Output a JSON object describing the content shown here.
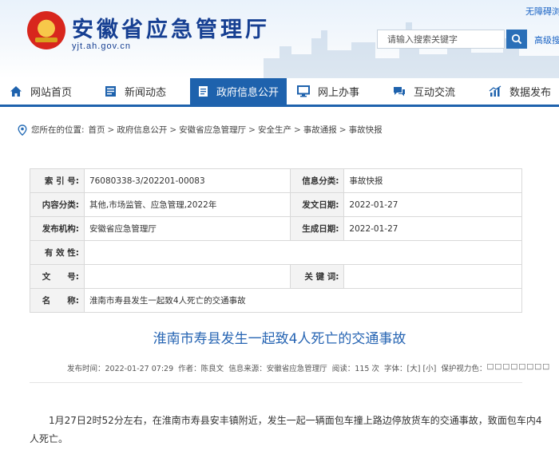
{
  "header": {
    "site_title": "安徽省应急管理厅",
    "site_domain": "yjt.ah.gov.cn",
    "a11y_link": "无障碍浏",
    "search_placeholder": "请输入搜索关键字",
    "advanced_search": "高级搜"
  },
  "nav": {
    "items": [
      {
        "label": "网站首页",
        "icon": "home-icon"
      },
      {
        "label": "新闻动态",
        "icon": "news-icon"
      },
      {
        "label": "政府信息公开",
        "icon": "document-icon",
        "active": true
      },
      {
        "label": "网上办事",
        "icon": "monitor-icon"
      },
      {
        "label": "互动交流",
        "icon": "chat-icon"
      },
      {
        "label": "数据发布",
        "icon": "chart-icon"
      }
    ]
  },
  "breadcrumb": {
    "prefix": "您所在的位置:",
    "items": [
      "首页",
      "政府信息公开",
      "安徽省应急管理厅",
      "安全生产",
      "事故通报",
      "事故快报"
    ],
    "separator": ">"
  },
  "info": {
    "rows": [
      {
        "k1": "索 引 号:",
        "v1": "76080338-3/202201-00083",
        "k2": "信息分类:",
        "v2": "事故快报"
      },
      {
        "k1": "内容分类:",
        "v1": "其他,市场监管、应急管理,2022年",
        "k2": "发文日期:",
        "v2": "2022-01-27"
      },
      {
        "k1": "发布机构:",
        "v1": "安徽省应急管理厅",
        "k2": "生成日期:",
        "v2": "2022-01-27"
      },
      {
        "k1": "有 效 性:",
        "v1": ""
      },
      {
        "k1": "文　　号:",
        "v1": "",
        "k2": "关 键 词:",
        "v2": ""
      },
      {
        "k1": "名　　称:",
        "v1": "淮南市寿县发生一起致4人死亡的交通事故"
      }
    ]
  },
  "article": {
    "title": "淮南市寿县发生一起致4人死亡的交通事故",
    "meta": {
      "publish_time": "发布时间：2022-01-27 07:29",
      "author": "作者：陈良文",
      "source": "信息来源：安徽省应急管理厅",
      "views": "阅读：115 次",
      "font_size": "字体：",
      "font_large": "[大]",
      "font_small": "[小]",
      "eye_care": "保护视力色：",
      "color_swatches": "□□□□□□□□"
    },
    "body": "1月27日2时52分左右，在淮南市寿县安丰镇附近，发生一起一辆面包车撞上路边停放货车的交通事故，致面包车内4人死亡。"
  },
  "colors": {
    "brand_blue": "#1e62ad",
    "title_blue": "#163f92",
    "link_blue": "#2765b3"
  }
}
